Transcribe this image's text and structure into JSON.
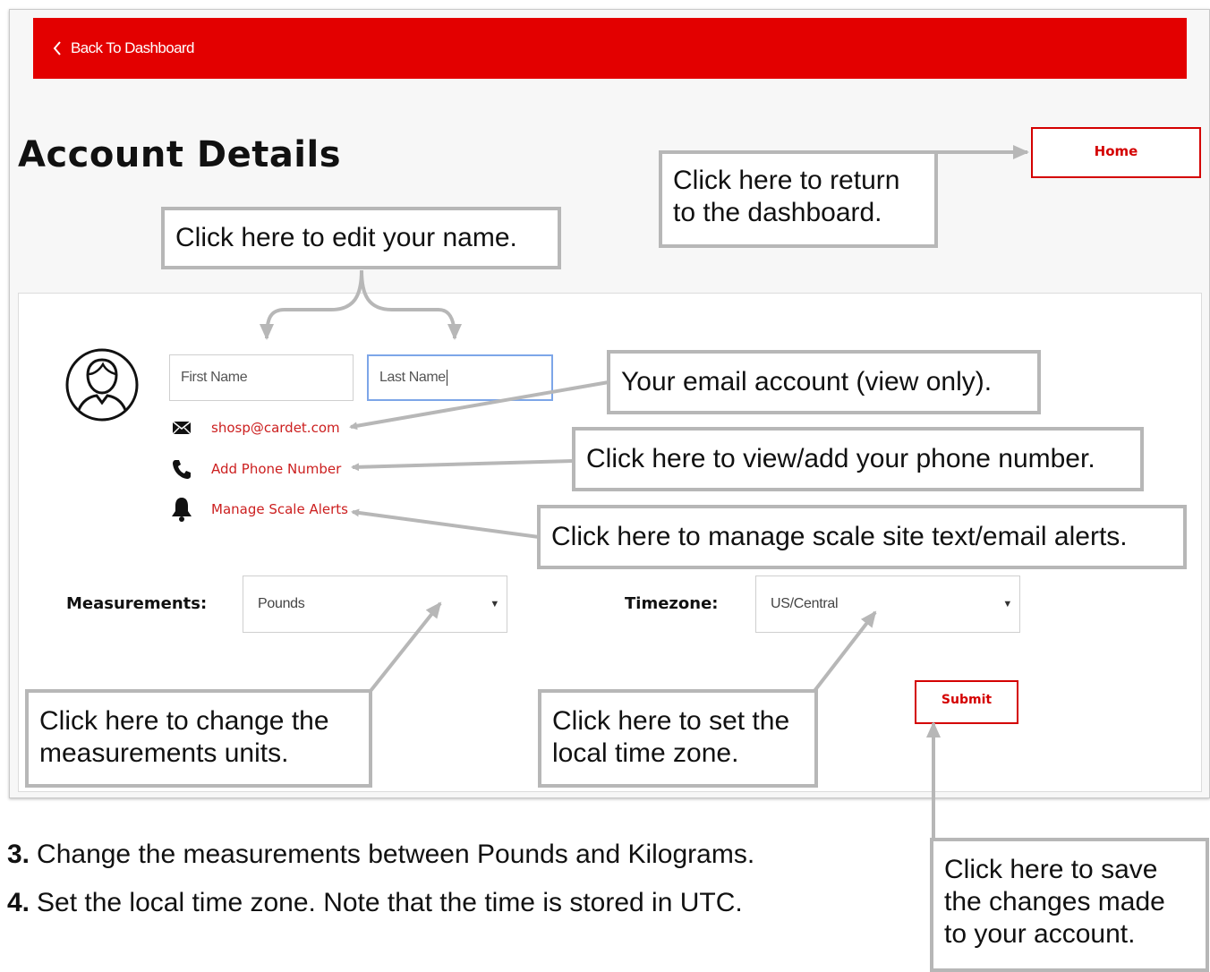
{
  "header": {
    "back_label": "Back To Dashboard",
    "accent_color": "#e30000"
  },
  "page": {
    "title": "Account Details",
    "home_label": "Home"
  },
  "profile": {
    "first_name_placeholder": "First Name",
    "last_name_value": "Last Name",
    "email": "shosp@cardet.com",
    "add_phone_label": "Add Phone Number",
    "manage_alerts_label": "Manage Scale Alerts"
  },
  "settings": {
    "measurements_label": "Measurements:",
    "measurements_value": "Pounds",
    "timezone_label": "Timezone:",
    "timezone_value": "US/Central",
    "submit_label": "Submit"
  },
  "icons": {
    "back": "chevron-left-icon",
    "avatar": "user-avatar-icon",
    "email": "envelope-icon",
    "phone": "phone-icon",
    "alerts": "bell-icon",
    "dropdown": "caret-down-icon"
  },
  "callouts": {
    "home": "Click here to return to the dashboard.",
    "name": "Click here to edit your name.",
    "email": "Your email account (view only).",
    "phone": "Click here to view/add your phone number.",
    "alerts": "Click here to manage scale site text/email alerts.",
    "measurements": "Click here to change the measurements units.",
    "timezone": "Click here to set the local time zone.",
    "submit": "Click here to save the changes made to your account."
  },
  "steps": [
    {
      "num": "3.",
      "text": "Change the measurements between Pounds and Kilograms."
    },
    {
      "num": "4.",
      "text": "Set the local time zone. Note that the time is stored in UTC."
    }
  ]
}
